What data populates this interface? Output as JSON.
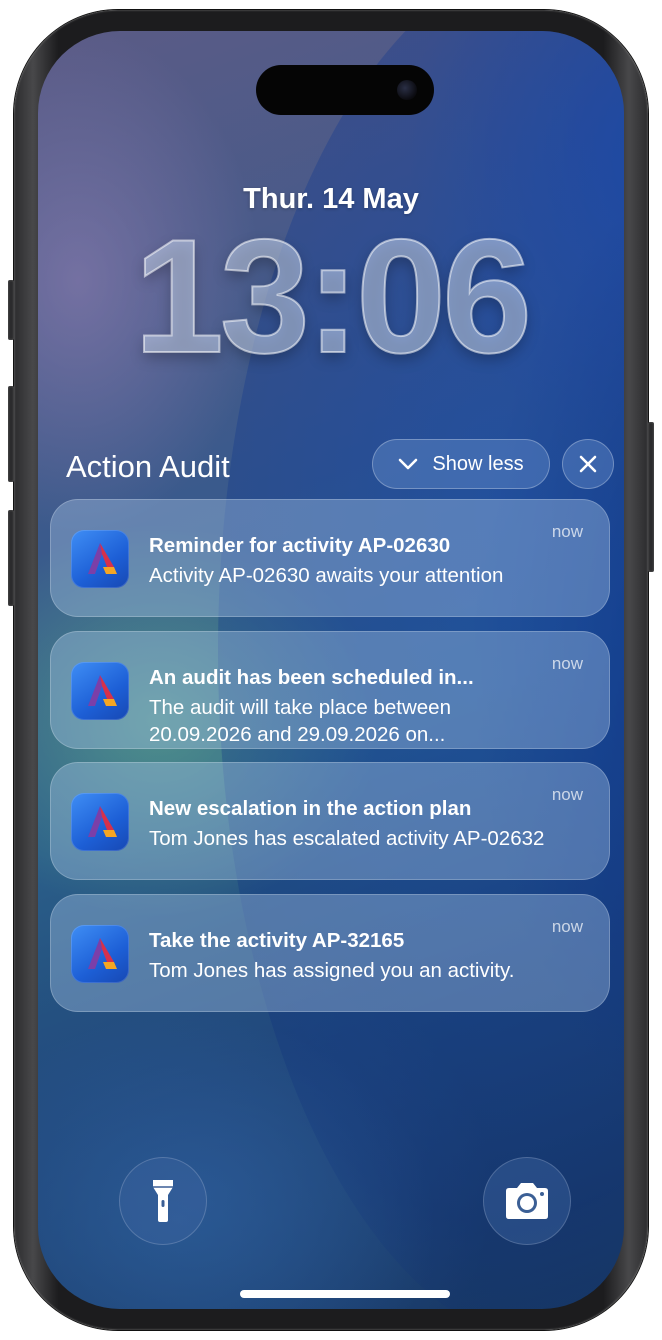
{
  "lockscreen": {
    "date": "Thur. 14 May",
    "time": "13:06"
  },
  "group": {
    "title": "Action Audit",
    "show_less_label": "Show less"
  },
  "notifications": [
    {
      "app_icon": "action-audit-app-icon",
      "title": "Reminder for activity AP-02630",
      "body": "Activity AP-02630 awaits your attention",
      "time": "now"
    },
    {
      "app_icon": "action-audit-app-icon",
      "title": "An audit has been scheduled in...",
      "body": "The audit will take place between 20.09.2026 and 29.09.2026 on...",
      "time": "now"
    },
    {
      "app_icon": "action-audit-app-icon",
      "title": "New escalation in the action plan",
      "body": "Tom Jones has escalated activity AP-02632",
      "time": "now"
    },
    {
      "app_icon": "action-audit-app-icon",
      "title": "Take the activity AP-32165",
      "body": "Tom Jones has assigned you an activity.",
      "time": "now"
    }
  ],
  "quick_actions": {
    "left_icon": "flashlight-icon",
    "right_icon": "camera-icon"
  },
  "colors": {
    "app_icon_blue": "#1d5fd6",
    "logo_purple": "#7b3fa8",
    "logo_red": "#d6314b",
    "logo_orange": "#f5a623"
  }
}
